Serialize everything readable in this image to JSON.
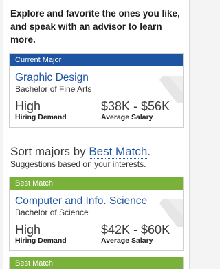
{
  "intro": {
    "text": "Explore and favorite the ones you like, and speak with an advisor to learn more."
  },
  "current_card": {
    "header": "Current Major",
    "major": "Graphic Design",
    "degree": "Bachelor of Fine Arts",
    "demand_value": "High",
    "demand_label": "Hiring Demand",
    "salary_value": "$38K - $56K",
    "salary_label": "Average Salary"
  },
  "sort": {
    "prefix": "Sort majors by ",
    "link": "Best Match",
    "suffix": ".",
    "subtitle": "Suggestions based on your interests."
  },
  "match_card": {
    "header": "Best Match",
    "major": "Computer and Info. Science",
    "degree": "Bachelor of Science",
    "demand_value": "High",
    "demand_label": "Hiring Demand",
    "salary_value": "$42K - $60K",
    "salary_label": "Average Salary"
  },
  "next_card": {
    "header": "Best Match"
  },
  "colors": {
    "primary_blue": "#1f54a3",
    "match_green": "#7ab13a"
  },
  "icons": {
    "favorite_tab": "favorite-ribbon-icon"
  }
}
